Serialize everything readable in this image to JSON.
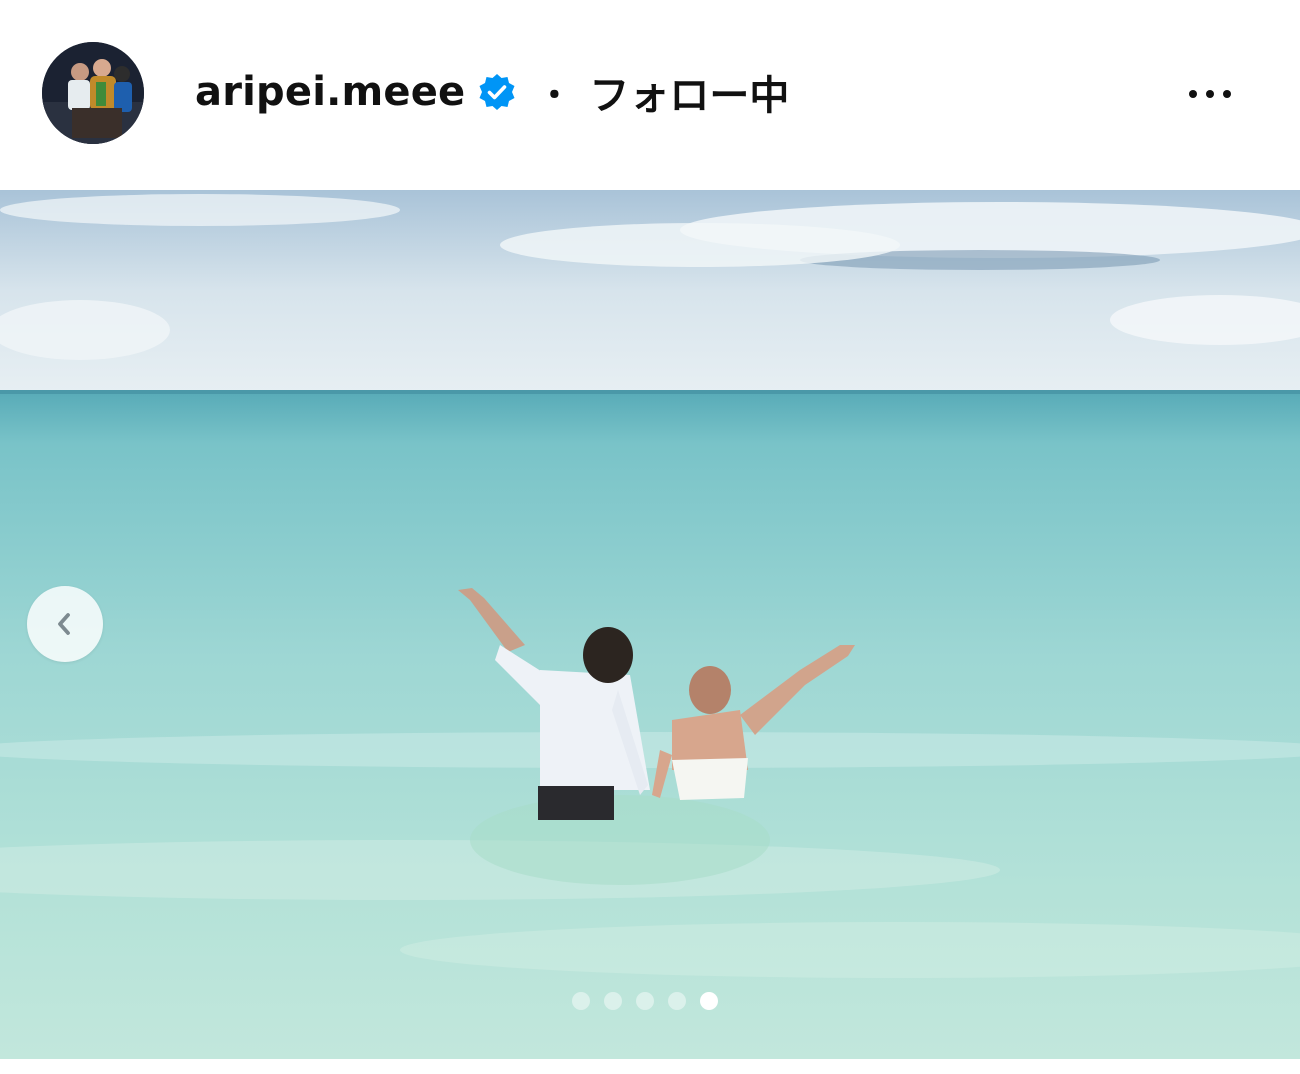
{
  "post": {
    "username": "aripei.meee",
    "separator": "・",
    "follow_status": "フォロー中",
    "verified": true
  },
  "icons": {
    "verified": "verified-badge-icon",
    "more": "more-options-icon",
    "prev": "chevron-left-icon"
  },
  "carousel": {
    "total": 5,
    "current": 5
  },
  "colors": {
    "verified_blue": "#0095f6",
    "text": "#111111"
  }
}
